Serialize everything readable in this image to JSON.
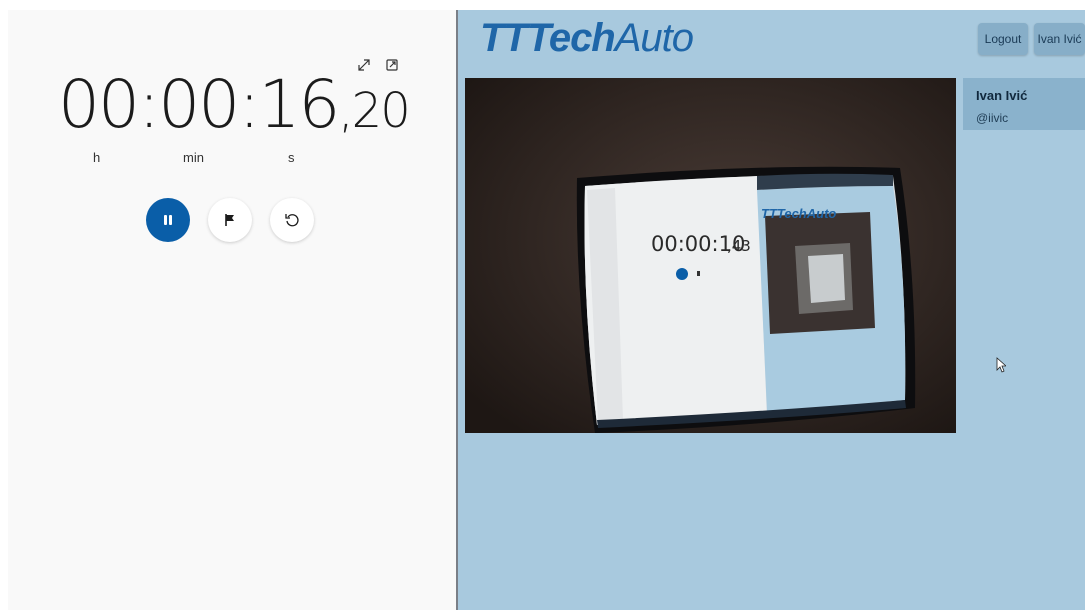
{
  "stopwatch": {
    "time_main": "00:00:16",
    "time_fraction": ",20",
    "units": {
      "hours": "h",
      "minutes": "min",
      "seconds": "s"
    },
    "icons": [
      "expand-icon",
      "keep-on-top-icon"
    ],
    "controls": [
      {
        "name": "pause-button",
        "icon": "pause-icon"
      },
      {
        "name": "lap-button",
        "icon": "flag-icon"
      },
      {
        "name": "reset-button",
        "icon": "reset-icon"
      }
    ],
    "accent_color": "#0a5ea8"
  },
  "app": {
    "logo_bold": "TTTech",
    "logo_light": "Auto",
    "logout_label": "Logout",
    "user_button_label": "Ivan Ivić",
    "profile": {
      "name": "Ivan Ivić",
      "handle": "@iivic"
    },
    "background_color": "#a8c9de",
    "brand_color": "#1f66a8"
  },
  "video_feed": {
    "inner_stopwatch_time": "00:00:10",
    "inner_stopwatch_fraction": ",43",
    "inner_logo": "TTTechAuto"
  }
}
